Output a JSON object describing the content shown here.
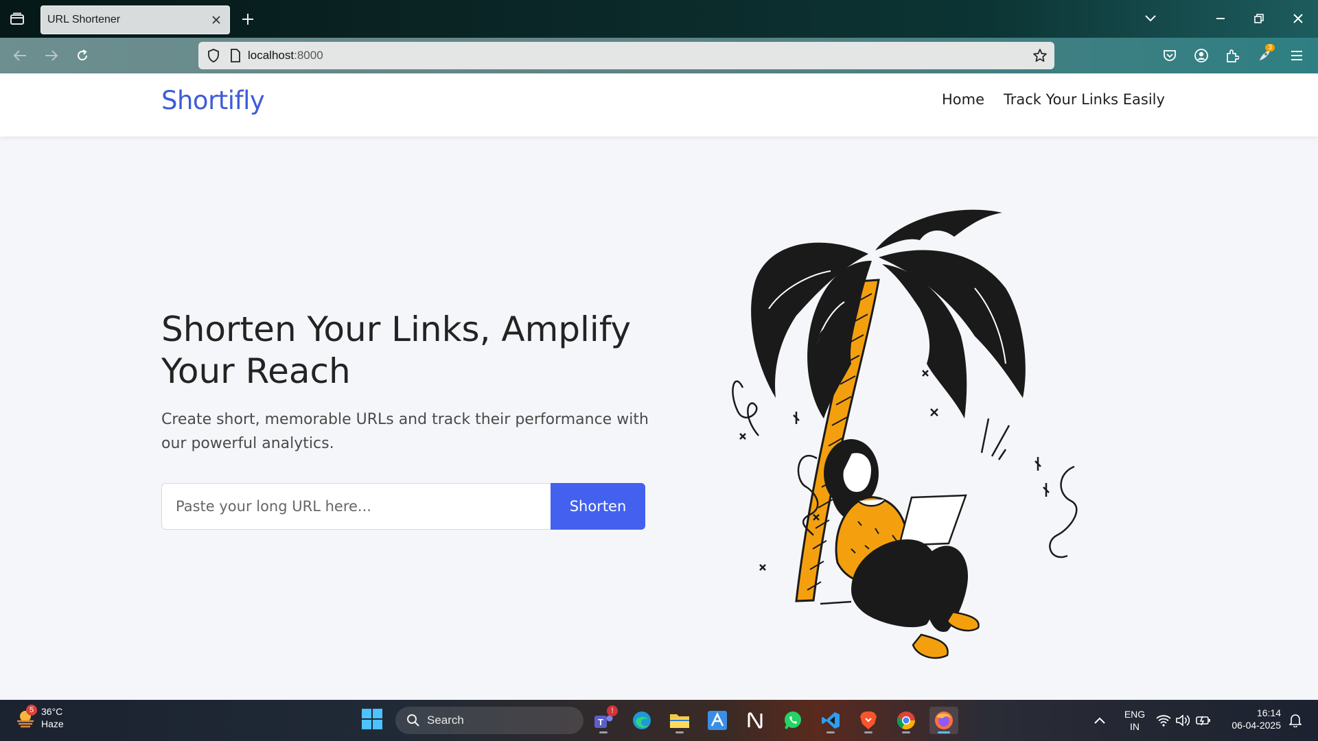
{
  "browser": {
    "tab_title": "URL Shortener",
    "url_host": "localhost",
    "url_port": ":8000",
    "extensions_badge": "3"
  },
  "site": {
    "brand": "Shortifly",
    "nav": [
      "Home",
      "Track Your Links Easily"
    ],
    "hero_title": "Shorten Your Links, Amplify Your Reach",
    "hero_subtitle": "Create short, memorable URLs and track their performance with our powerful analytics.",
    "input_placeholder": "Paste your long URL here...",
    "shorten_label": "Shorten"
  },
  "taskbar": {
    "weather_badge": "5",
    "temperature": "36°C",
    "condition": "Haze",
    "search_label": "Search",
    "teams_badge": "!",
    "language_line1": "ENG",
    "language_line2": "IN",
    "time": "16:14",
    "date": "06-04-2025"
  },
  "colors": {
    "brand_blue": "#3f5bd8",
    "button_blue": "#4361ee",
    "illustration_orange": "#f4a00e"
  }
}
